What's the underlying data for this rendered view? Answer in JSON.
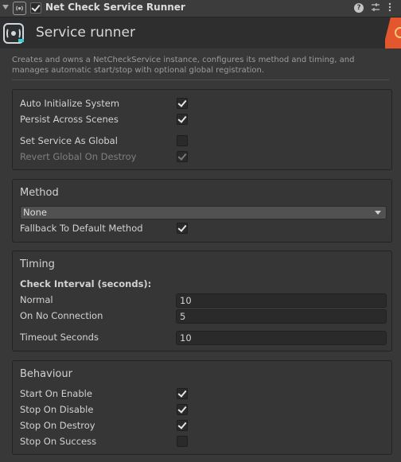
{
  "header": {
    "component_title": "Net Check Service Runner",
    "icons": [
      "foldout-icon",
      "broadcast-icon",
      "enable-checkbox",
      "help-icon",
      "preset-sliders-icon",
      "kebab-menu-icon"
    ]
  },
  "banner": {
    "title": "Service runner",
    "description": "Creates and owns a NetCheckService instance, configures its method and timing, and manages automatic start/stop with optional global registration."
  },
  "system": {
    "auto_initialize": {
      "label": "Auto Initialize System",
      "checked": true
    },
    "persist_across_scenes": {
      "label": "Persist Across Scenes",
      "checked": true
    },
    "set_service_as_global": {
      "label": "Set Service As Global",
      "checked": false
    },
    "revert_global_on_destroy": {
      "label": "Revert Global On Destroy",
      "checked": true,
      "disabled": true
    }
  },
  "method": {
    "title": "Method",
    "selected": "None",
    "fallback": {
      "label": "Fallback To Default Method",
      "checked": true
    }
  },
  "timing": {
    "title": "Timing",
    "interval_heading": "Check Interval (seconds):",
    "normal": {
      "label": "Normal",
      "value": "10"
    },
    "no_connection": {
      "label": "On No Connection",
      "value": "5"
    },
    "timeout": {
      "label": "Timeout Seconds",
      "value": "10"
    }
  },
  "behaviour": {
    "title": "Behaviour",
    "start_on_enable": {
      "label": "Start On Enable",
      "checked": true
    },
    "stop_on_disable": {
      "label": "Stop On Disable",
      "checked": true
    },
    "stop_on_destroy": {
      "label": "Stop On Destroy",
      "checked": true
    },
    "stop_on_success": {
      "label": "Stop On Success",
      "checked": false
    }
  },
  "colors": {
    "background": "#383838",
    "banner": "#2e2e2e",
    "accent_cyan": "#2fd0d8",
    "brand_orange": "#e4572e"
  }
}
